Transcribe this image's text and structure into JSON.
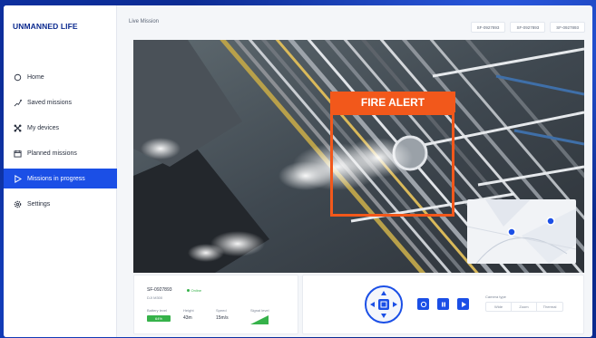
{
  "brand": {
    "logo": "UNMANNED LIFE"
  },
  "sidebar": {
    "items": [
      {
        "label": "Home",
        "icon": "home-icon",
        "active": false
      },
      {
        "label": "Saved missions",
        "icon": "route-icon",
        "active": false
      },
      {
        "label": "My devices",
        "icon": "drone-icon",
        "active": false
      },
      {
        "label": "Planned missions",
        "icon": "calendar-icon",
        "active": false
      },
      {
        "label": "Missions in progress",
        "icon": "play-icon",
        "active": true
      },
      {
        "label": "Settings",
        "icon": "gear-icon",
        "active": false
      }
    ]
  },
  "header": {
    "title": "Live Mission",
    "device_tabs": [
      "SF-0927893",
      "SF-0927893",
      "SF-0927893"
    ]
  },
  "video": {
    "alert_label": "FIRE ALERT"
  },
  "telemetry": {
    "device_id": "SF-0927893",
    "status": "Online",
    "subtitle": "DJI M300",
    "battery_label": "Battery level",
    "battery_value": "64%",
    "height_label": "Height",
    "height_value": "43m",
    "speed_label": "Speed",
    "speed_value": "15m/s",
    "signal_label": "Signal level"
  },
  "camera": {
    "label": "Camera type",
    "options": [
      "Wide",
      "Zoom",
      "Thermal"
    ]
  },
  "colors": {
    "accent": "#1b4fe6",
    "alert": "#f2581b",
    "online": "#36b24a"
  }
}
